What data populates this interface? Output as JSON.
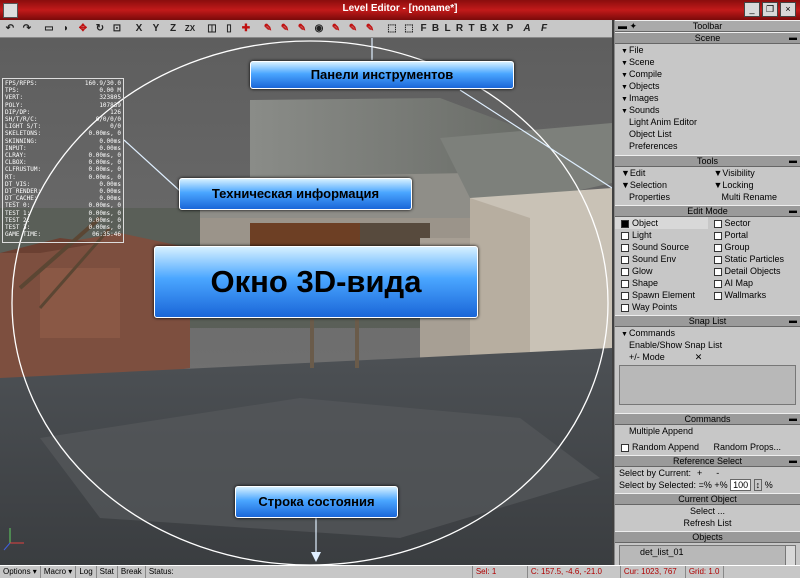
{
  "window": {
    "title": "Level Editor - [noname*]",
    "min_glyph": "_",
    "restore_glyph": "❐",
    "close_glyph": "×"
  },
  "toolbar_left": {
    "icons": [
      "undo-icon",
      "redo-icon",
      "select-icon",
      "move-icon",
      "rotate-icon",
      "scale-icon",
      "lock-x-icon",
      "lock-y-icon",
      "lock-z-icon",
      "lock-zx-icon"
    ],
    "axis_labels": [
      "X",
      "Y",
      "Z",
      "ZX"
    ],
    "snap_letters": [
      "F",
      "B",
      "L",
      "R",
      "T",
      "B",
      "X"
    ]
  },
  "info_overlay": {
    "rows": [
      [
        "FPS/RFPS:",
        "160.9/30.0"
      ],
      [
        "TPS:",
        "0.00 M"
      ],
      [
        "VERT:",
        "323805"
      ],
      [
        "POLY:",
        "107839"
      ],
      [
        "DIP/DP:",
        "126"
      ],
      [
        "SH/T/R/C:",
        "0/0/0/0"
      ],
      [
        "LIGHT S/T:",
        "0/0"
      ],
      [
        "SKELETONS:",
        "0.00ms, 0"
      ],
      [
        "SKINNING:",
        "0.00ms"
      ],
      [
        "",
        ""
      ],
      [
        "INPUT:",
        "0.00ms"
      ],
      [
        "CLRAY:",
        "0.00ms, 0"
      ],
      [
        "CLBOX:",
        "0.00ms, 0"
      ],
      [
        "CLFRUSTUM:",
        "0.00ms, 0"
      ],
      [
        "",
        ""
      ],
      [
        "RT:",
        "0.00ms, 0"
      ],
      [
        "DT_VIS:",
        "0.00ms"
      ],
      [
        "DT_RENDER:",
        "0.00ms"
      ],
      [
        "DT_CACHE:",
        "0.00ms"
      ],
      [
        "",
        ""
      ],
      [
        "TEST 0:",
        "0.00ms, 0"
      ],
      [
        "TEST 1:",
        "0.00ms, 0"
      ],
      [
        "TEST 2:",
        "0.00ms, 0"
      ],
      [
        "TEST 3:",
        "0.00ms, 0"
      ],
      [
        "",
        ""
      ],
      [
        "GAME TIME:",
        "06:35:46"
      ]
    ]
  },
  "callouts": {
    "toolbars": "Панели инструментов",
    "tech_info": "Техническая информация",
    "viewport": "Окно 3D-вида",
    "statusbar": "Строка состояния"
  },
  "panel": {
    "toolbar_title": "Toolbar",
    "scene": {
      "title": "Scene",
      "items": [
        "File",
        "Scene",
        "Compile",
        "Objects",
        "Images",
        "Sounds",
        "Light Anim Editor",
        "Object List",
        "Preferences"
      ]
    },
    "tools": {
      "title": "Tools",
      "left": [
        "Edit",
        "Selection",
        "Properties"
      ],
      "right": [
        "Visibility",
        "Locking",
        "Multi Rename"
      ]
    },
    "edit_mode": {
      "title": "Edit Mode",
      "left": [
        "Object",
        "Light",
        "Sound Source",
        "Sound Env",
        "Glow",
        "Shape",
        "Spawn Element",
        "Way Points"
      ],
      "right": [
        "Sector",
        "Portal",
        "Group",
        "Static Particles",
        "Detail Objects",
        "AI Map",
        "Wallmarks"
      ]
    },
    "snap_list": {
      "title": "Snap List",
      "commands": "Commands",
      "enable": "Enable/Show Snap List",
      "mode": "+/- Mode",
      "x": "✕"
    },
    "commands": {
      "title": "Commands",
      "multiple_append": "Multiple Append",
      "random_append": "Random Append",
      "random_props": "Random Props..."
    },
    "reference_select": {
      "title": "Reference Select",
      "by_current": "Select by Current:",
      "by_current_plus": "+",
      "by_current_minus": "-",
      "by_selected": "Select by Selected:",
      "eq_percent": "=%",
      "plus_percent": "+%",
      "value": "100",
      "percent": "%"
    },
    "current_object": {
      "title": "Current Object",
      "select": "Select ...",
      "refresh": "Refresh List"
    },
    "objects": {
      "title": "Objects",
      "item": "det_list_01"
    }
  },
  "statusbar": {
    "options": "Options",
    "macro": "Macro",
    "log": "Log",
    "stat": "Stat",
    "break": "Break",
    "status": "Status:",
    "sel": "Sel: 1",
    "c": "C: 157.5, -4.6, -21.0",
    "cur": "Cur: 1023, 767",
    "grid": "Grid: 1.0"
  }
}
